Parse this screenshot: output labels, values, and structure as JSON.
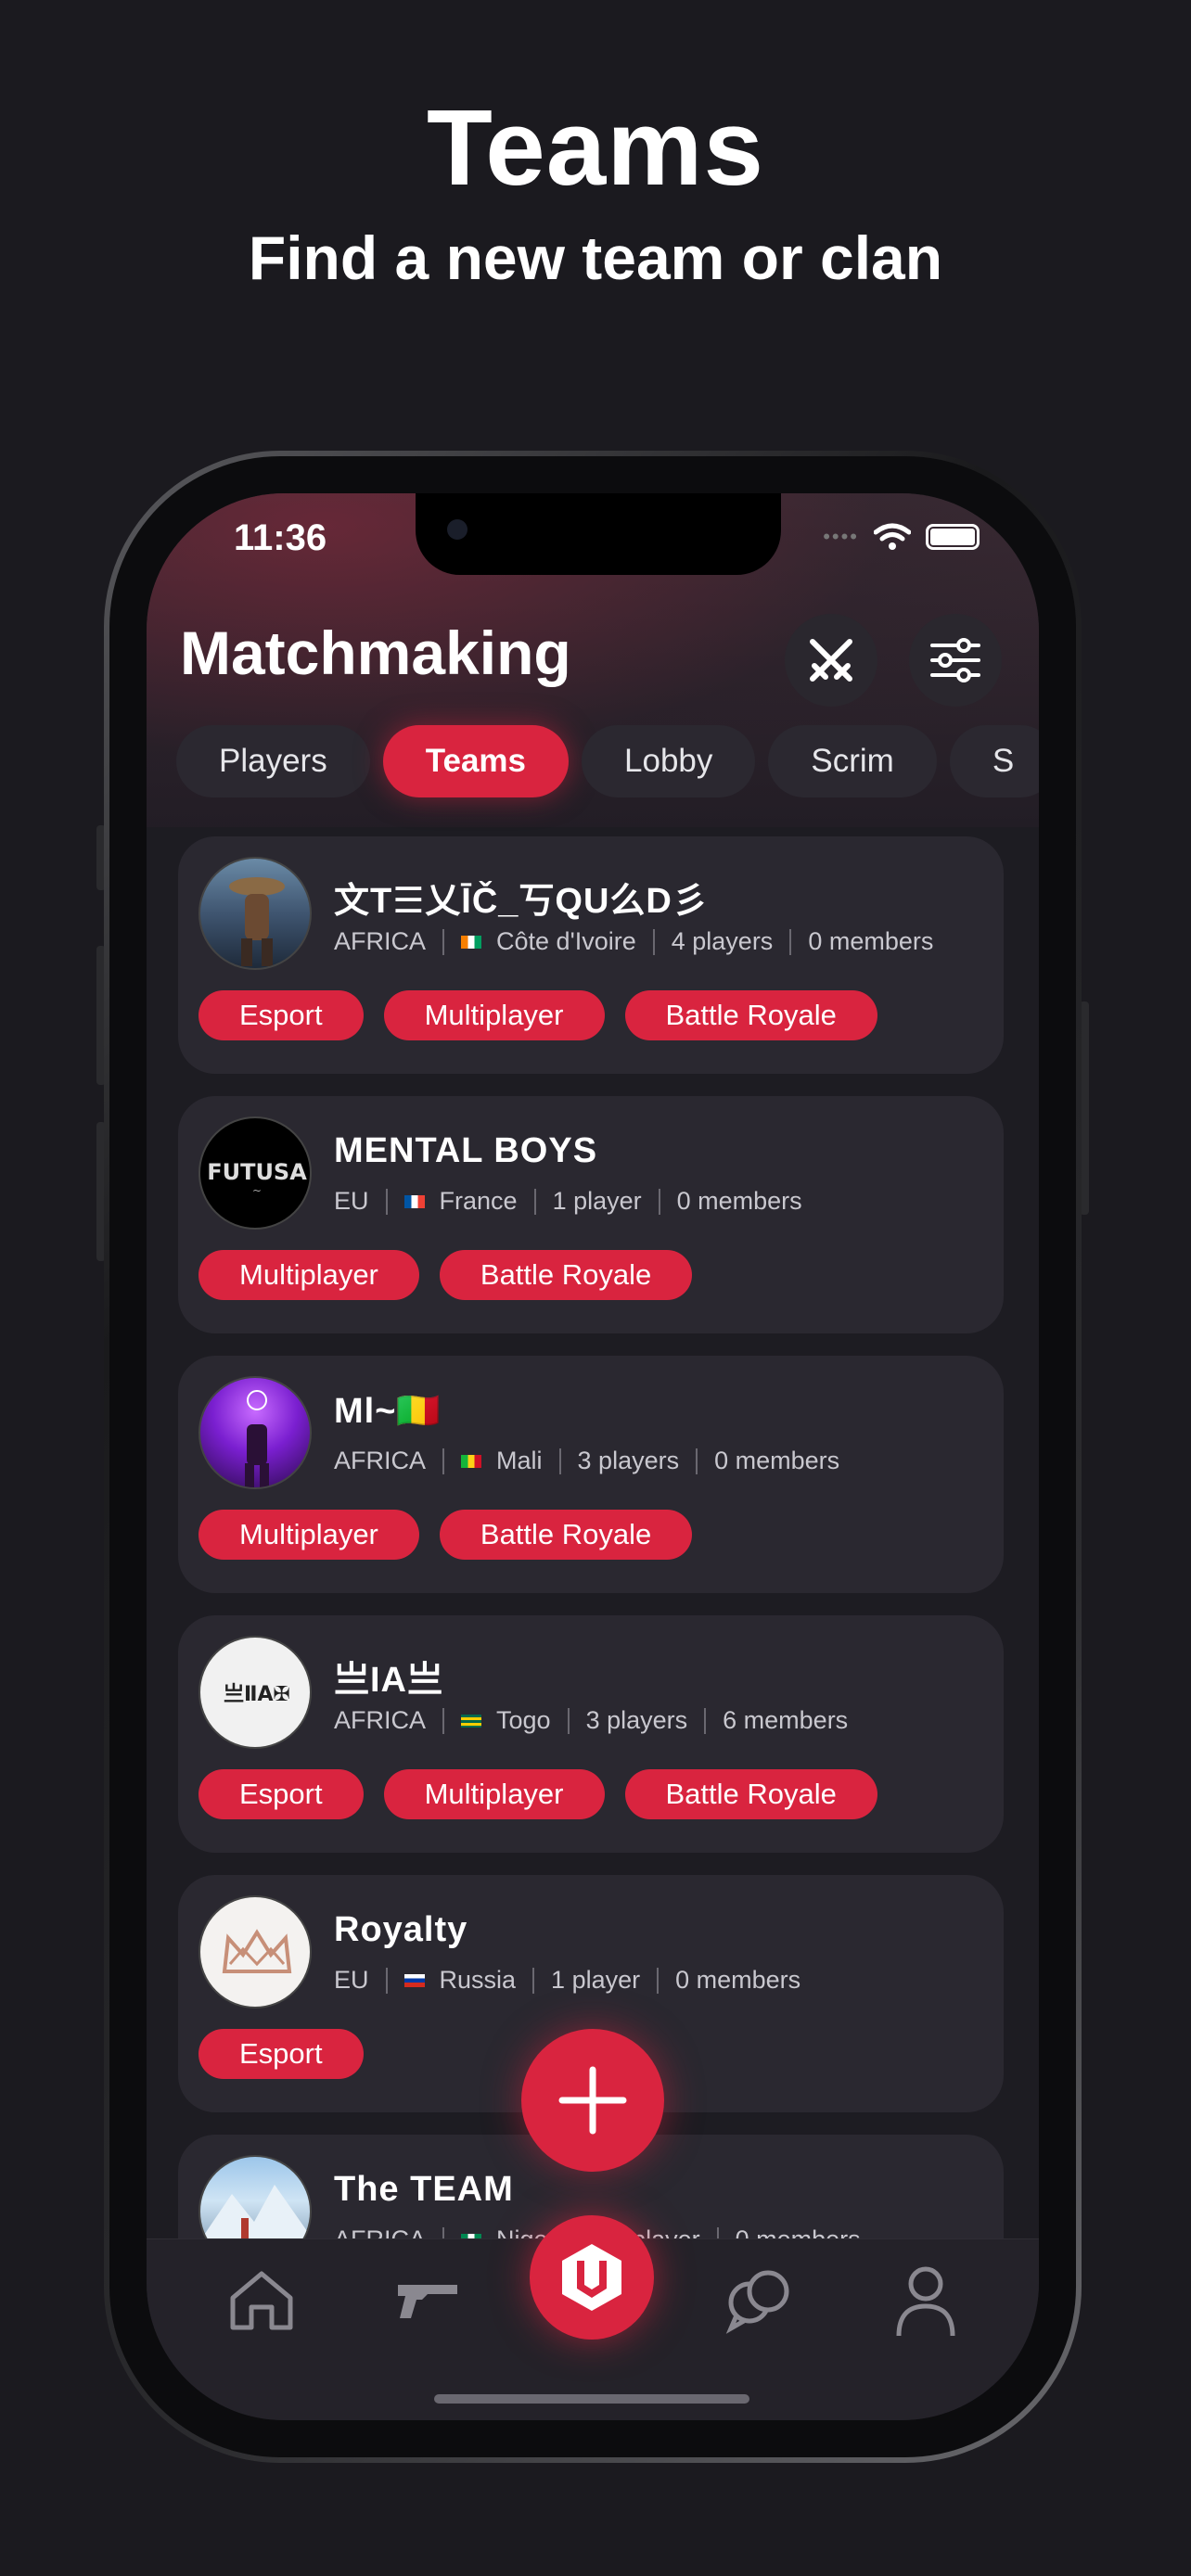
{
  "promo": {
    "title": "Teams",
    "subtitle": "Find a new team or clan"
  },
  "status_bar": {
    "time": "11:36",
    "signal": "••••"
  },
  "header": {
    "title": "Matchmaking",
    "icons": [
      "swords-icon",
      "sliders-icon"
    ]
  },
  "tabs": [
    {
      "label": "Players",
      "active": false
    },
    {
      "label": "Teams",
      "active": true
    },
    {
      "label": "Lobby",
      "active": false
    },
    {
      "label": "Scrim",
      "active": false
    },
    {
      "label": "S",
      "active": false
    }
  ],
  "teams": [
    {
      "name": "文T☰乂ĪČ_丂QU么D彡",
      "region": "AFRICA",
      "country": "Côte d'Ivoire",
      "players": "4 players",
      "members": "0 members",
      "tags": [
        "Esport",
        "Multiplayer",
        "Battle Royale"
      ]
    },
    {
      "name": "MENTAL BOYS",
      "region": "EU",
      "country": "France",
      "players": "1 player",
      "members": "0 members",
      "tags": [
        "Multiplayer",
        "Battle Royale"
      ]
    },
    {
      "name": "Ml~🇲🇱",
      "region": "AFRICA",
      "country": "Mali",
      "players": "3 players",
      "members": "0 members",
      "tags": [
        "Multiplayer",
        "Battle Royale"
      ]
    },
    {
      "name": "亗IA亗",
      "region": "AFRICA",
      "country": "Togo",
      "players": "3 players",
      "members": "6 members",
      "tags": [
        "Esport",
        "Multiplayer",
        "Battle Royale"
      ]
    },
    {
      "name": "Royalty",
      "region": "EU",
      "country": "Russia",
      "players": "1 player",
      "members": "0 members",
      "tags": [
        "Esport"
      ]
    },
    {
      "name": "The TEAM",
      "region": "AFRICA",
      "country": "Nigeria",
      "players": "1 player",
      "members": "0 members",
      "tags": []
    }
  ],
  "avatar_icons": [
    "warrior-avatar",
    "futusa-logo-avatar",
    "purple-figure-avatar",
    "ia-logo-avatar",
    "crown-logo-avatar",
    "mountain-avatar"
  ],
  "fab": {
    "icon": "plus-icon"
  },
  "bottom_nav": [
    "home-icon",
    "gun-icon",
    "brand-logo-icon",
    "chat-icon",
    "profile-icon"
  ],
  "colors": {
    "background": "#1b1a1f",
    "accent": "#d9243f",
    "card": "#2a2830"
  }
}
